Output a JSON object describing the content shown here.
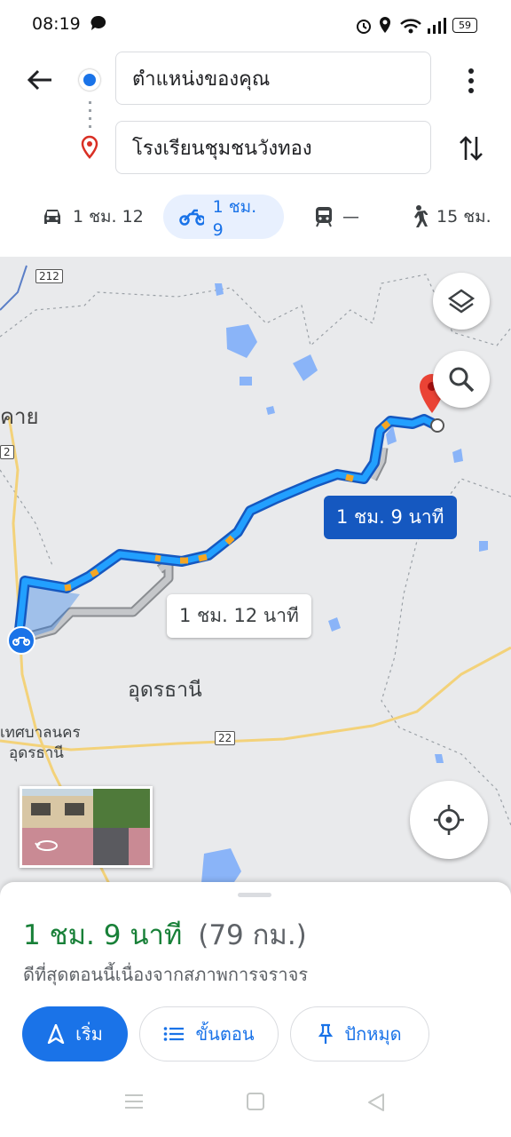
{
  "status": {
    "time": "08:19",
    "battery": "59"
  },
  "header": {
    "origin": "ตำแหน่งของคุณ",
    "destination": "โรงเรียนชุมชนวังทอง"
  },
  "modes": [
    {
      "name": "car",
      "icon": "car-icon",
      "label": "1 ชม. 12"
    },
    {
      "name": "motorcycle",
      "icon": "motorcycle-icon",
      "label": "1 ชม. 9",
      "selected": true
    },
    {
      "name": "transit",
      "icon": "train-icon",
      "label": "—"
    },
    {
      "name": "walk",
      "icon": "walking-icon",
      "label": "15 ชม."
    }
  ],
  "map": {
    "selected_route_label": "1 ชม. 9 นาที",
    "alt_route_label": "1 ชม. 12 นาที",
    "city_label": "อุดรธานี",
    "municipality_label_1": "เทศบาลนคร",
    "municipality_label_2": "อุดรธานี",
    "place_partial": "คาย",
    "road_212": "212",
    "road_2": "2",
    "road_22": "22",
    "colors": {
      "route": "#1a73e8",
      "route_fill": "#22a0ff",
      "alt_route": "#b5b7bb",
      "water": "#8ab4f8"
    }
  },
  "sheet": {
    "duration": "1 ชม. 9 นาที",
    "distance": "(79 กม.)",
    "note": "ดีที่สุดตอนนี้เนื่องจากสภาพการจราจร",
    "start": "เริ่ม",
    "steps": "ขั้นตอน",
    "pin": "ปักหมุด"
  }
}
